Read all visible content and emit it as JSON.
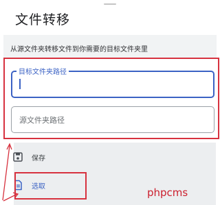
{
  "page": {
    "title": "文件转移",
    "description": "从源文件夹转移文件到你需要的目标文件夹里"
  },
  "form": {
    "target_field": {
      "label": "目标文件夹路径",
      "value": ""
    },
    "source_field": {
      "placeholder": "源文件夹路径",
      "value": ""
    }
  },
  "actions": {
    "save": {
      "label": "保存",
      "icon": "save-icon"
    },
    "select": {
      "label": "选取",
      "icon": "document-icon"
    }
  },
  "watermark": "phpcms",
  "colors": {
    "accent": "#3b62c4",
    "annotation_red": "#d7313e",
    "action_panel": "#eceef0"
  }
}
